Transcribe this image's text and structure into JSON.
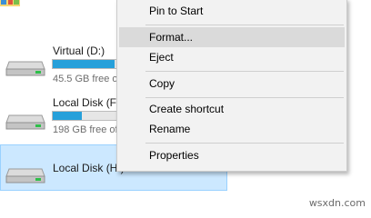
{
  "drives": [
    {
      "name": "Virtual (D:)",
      "free_text": "45.5 GB free o",
      "usage_fraction": 0.97,
      "selected": false
    },
    {
      "name": "Local Disk (F:)",
      "free_text": "198 GB free of",
      "usage_fraction": 0.45,
      "selected": false
    },
    {
      "name": "Local Disk (H:)",
      "free_text": "",
      "usage_fraction": null,
      "selected": true
    }
  ],
  "context_menu": {
    "items": [
      {
        "label": "Pin to Start"
      },
      {
        "label": "Format..."
      },
      {
        "label": "Eject"
      },
      {
        "label": "Copy"
      },
      {
        "label": "Create shortcut"
      },
      {
        "label": "Rename"
      },
      {
        "label": "Properties"
      }
    ],
    "highlighted": "Format..."
  },
  "watermark": "wsxdn.com",
  "colors": {
    "bar_fill": "#26a0da",
    "selection_bg": "#cce8ff",
    "menu_bg": "#f2f2f2",
    "menu_highlight": "#dadada"
  },
  "icons": [
    "drive-icon",
    "folder-icon"
  ]
}
